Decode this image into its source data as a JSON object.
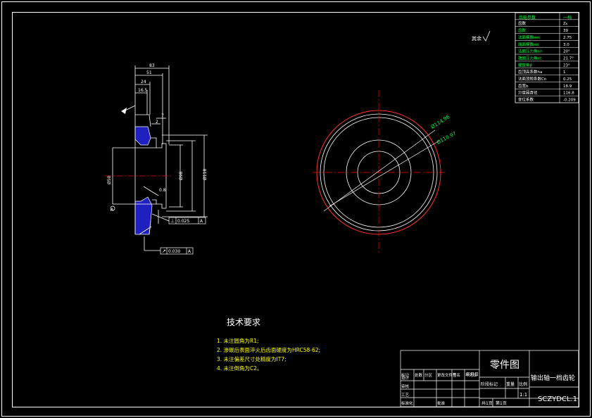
{
  "drawing": {
    "tech_req_title": "技术要求",
    "tech_req_items": [
      "1. 未注圆角为R1;",
      "2. 渗碳后表面淬火后齿面硬度为HRC58-62;",
      "3. 未注偏差尺寸处精度为IT7;",
      "4. 未注倒角为C2。"
    ],
    "roughness_label": "其余",
    "dims_side": [
      "83",
      "51",
      "24",
      "16.5",
      "7",
      "2",
      "0.8",
      "Ø50",
      "Ø98",
      "Ø118"
    ],
    "datum_labels": [
      "A",
      "A"
    ],
    "tolerance_frames": [
      {
        "symbol": "⊥",
        "value": "0.025",
        "datum": "A"
      },
      {
        "symbol": "↗",
        "value": "0.030",
        "datum": "A"
      }
    ],
    "dims_front": [
      "Ø114.96",
      "Ø110.97"
    ]
  },
  "param_table": {
    "header": [
      "齿轮参数",
      "一档"
    ],
    "rows": [
      [
        "齿数",
        "Z₆"
      ],
      [
        "齿数",
        "39"
      ],
      [
        "法面模数mn",
        "2.75"
      ],
      [
        "端面模数mt",
        "3.0"
      ],
      [
        "法面压力角αn",
        "20°"
      ],
      [
        "端面压力角αt",
        "21.7°"
      ],
      [
        "螺旋角β",
        "23°"
      ],
      [
        "齿顶高系数ha",
        "1"
      ],
      [
        "法面顶隙系数Cn",
        "0.25"
      ],
      [
        "齿宽b",
        "18.9"
      ],
      [
        "分度圆直径",
        "116.8"
      ],
      [
        "变位系数",
        "-0.209"
      ]
    ]
  },
  "title_block": {
    "title": "零件图",
    "part_name": "输出轴一档齿轮",
    "code": "SCZYDCL.1",
    "scale": "1:1",
    "sheet_total": "共1页",
    "sheet_no": "第1页",
    "stage_mark": "阶段标记",
    "weight": "重量",
    "scale_label": "比例",
    "rev_labels": [
      "标记",
      "处数",
      "分区",
      "更改文件号",
      "签名",
      "年月日"
    ],
    "roles": [
      "设计",
      "审核",
      "工艺",
      "标准化",
      "批准"
    ],
    "date_label": "年月日"
  },
  "colors": {
    "yellow": "#ffff00",
    "red": "#ff0000",
    "blue": "#2020c0",
    "green": "#00ff40",
    "white": "#ffffff"
  }
}
